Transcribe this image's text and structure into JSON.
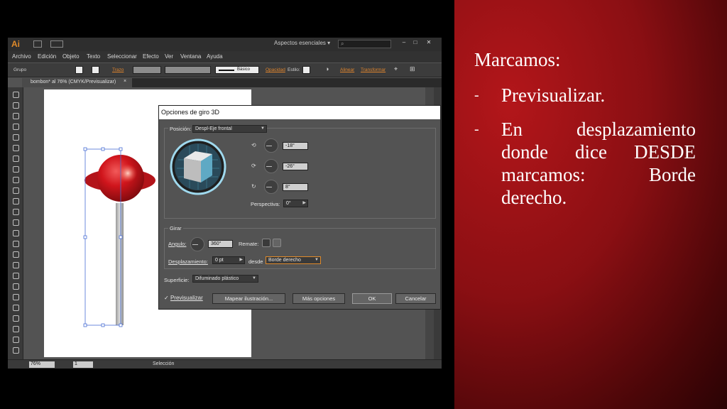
{
  "slide": {
    "heading": "Marcamos:",
    "bullets": [
      {
        "dash": "-",
        "text": "Previsualizar."
      },
      {
        "dash": "-",
        "text": "En desplazamiento donde dice DESDE marcamos: Borde derecho."
      }
    ]
  },
  "app": {
    "logo": "Ai",
    "workspace": "Aspectos esenciales",
    "workspace_caret": "▾",
    "search_icon": "⌕",
    "window_buttons": [
      "–",
      "□",
      "✕"
    ],
    "menu": [
      "Archivo",
      "Edición",
      "Objeto",
      "Texto",
      "Seleccionar",
      "Efecto",
      "Ver",
      "Ventana",
      "Ayuda"
    ],
    "control": {
      "group_label": "Grupo",
      "stroke_label": "Trazo",
      "brush_label": "Básico",
      "opacity_label": "Opacidad",
      "style_label": "Estilo:",
      "align_label": "Alinear",
      "transform_label": "Transformar"
    },
    "doc_tab": "bombon* al 76% (CMYK/Previsualizar)",
    "doc_tab_close": "×",
    "status": {
      "zoom": "76%",
      "page": "1",
      "mode": "Selección"
    }
  },
  "dialog": {
    "title": "Opciones de giro 3D",
    "position_label": "Posición:",
    "position_value": "Despl-Eje frontal",
    "x_rotation": "-18°",
    "y_rotation": "-26°",
    "z_rotation": "8°",
    "perspective_label": "Perspectiva:",
    "perspective_value": "0°",
    "girar_label": "Girar",
    "angle_label": "Angulo:",
    "angle_value": "360°",
    "cap_label": "Remate:",
    "offset_label": "Desplazamiento:",
    "offset_value": "0 pt",
    "from_label": "desde",
    "from_value": "Borde derecho",
    "surface_label": "Superficie:",
    "surface_value": "Difuminado plástico",
    "preview_check": "✓",
    "preview_label": "Previsualizar",
    "buttons": {
      "map": "Mapear ilustración...",
      "more": "Más opciones",
      "ok": "OK",
      "cancel": "Cancelar"
    }
  },
  "colors": {
    "accent_orange": "#e08a2a",
    "lollipop_red": "#c8161d",
    "cube_face": "#5fa9c4",
    "selection_blue": "#4a6fd4"
  }
}
